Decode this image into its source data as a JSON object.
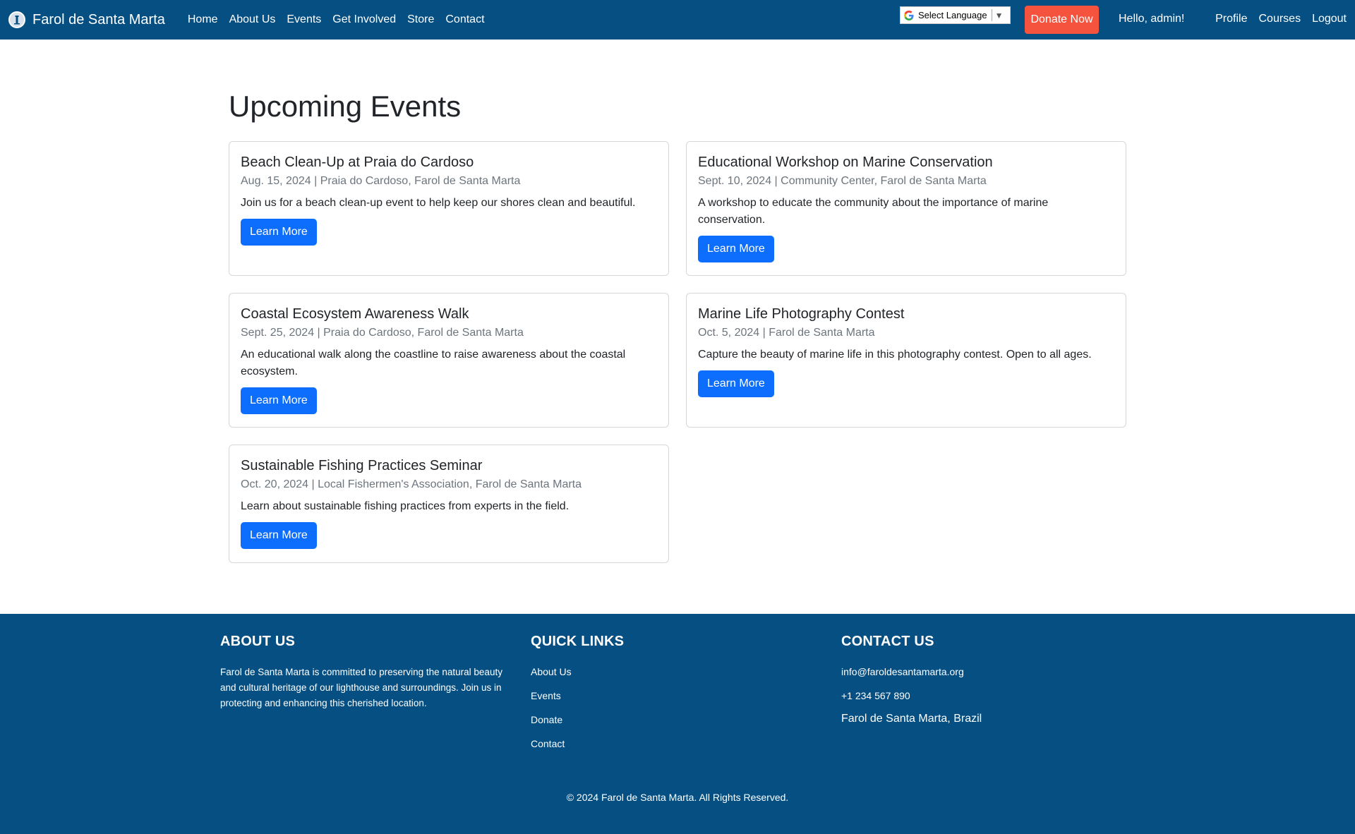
{
  "nav": {
    "brand": "Farol de Santa Marta",
    "links": [
      "Home",
      "About Us",
      "Events",
      "Get Involved",
      "Store",
      "Contact"
    ],
    "language_select": "Select Language",
    "donate": "Donate Now",
    "greeting": "Hello, admin!",
    "right_links": [
      "Profile",
      "Courses",
      "Logout"
    ]
  },
  "main": {
    "title": "Upcoming Events",
    "events": [
      {
        "title": "Beach Clean-Up at Praia do Cardoso",
        "meta": "Aug. 15, 2024 | Praia do Cardoso, Farol de Santa Marta",
        "description": "Join us for a beach clean-up event to help keep our shores clean and beautiful.",
        "button": "Learn More"
      },
      {
        "title": "Educational Workshop on Marine Conservation",
        "meta": "Sept. 10, 2024 | Community Center, Farol de Santa Marta",
        "description": "A workshop to educate the community about the importance of marine conservation.",
        "button": "Learn More"
      },
      {
        "title": "Coastal Ecosystem Awareness Walk",
        "meta": "Sept. 25, 2024 | Praia do Cardoso, Farol de Santa Marta",
        "description": "An educational walk along the coastline to raise awareness about the coastal ecosystem.",
        "button": "Learn More"
      },
      {
        "title": "Marine Life Photography Contest",
        "meta": "Oct. 5, 2024 | Farol de Santa Marta",
        "description": "Capture the beauty of marine life in this photography contest. Open to all ages.",
        "button": "Learn More"
      },
      {
        "title": "Sustainable Fishing Practices Seminar",
        "meta": "Oct. 20, 2024 | Local Fishermen's Association, Farol de Santa Marta",
        "description": "Learn about sustainable fishing practices from experts in the field.",
        "button": "Learn More"
      }
    ]
  },
  "footer": {
    "about": {
      "heading": "ABOUT US",
      "text": "Farol de Santa Marta is committed to preserving the natural beauty and cultural heritage of our lighthouse and surroundings. Join us in protecting and enhancing this cherished location."
    },
    "quick_links": {
      "heading": "QUICK LINKS",
      "links": [
        "About Us",
        "Events",
        "Donate",
        "Contact"
      ]
    },
    "contact": {
      "heading": "CONTACT US",
      "email": "info@faroldesantamarta.org",
      "phone": "+1 234 567 890",
      "location": "Farol de Santa Marta, Brazil"
    },
    "copyright": "© 2024 Farol de Santa Marta. All Rights Reserved."
  },
  "colors": {
    "navbar": "#054f82",
    "donate": "#f5533d",
    "primary_button": "#0d6efd"
  },
  "icons": {
    "brand_logo": "lighthouse-logo-icon",
    "language": "google-g-icon",
    "language_arrow": "dropdown-arrow-icon"
  }
}
